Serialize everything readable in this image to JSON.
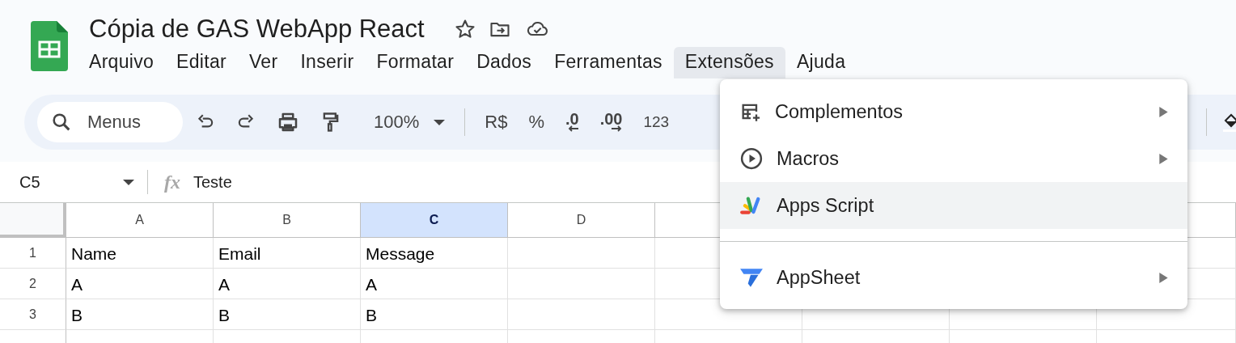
{
  "document": {
    "title": "Cópia de GAS WebApp React"
  },
  "menu_bar": [
    {
      "label": "Arquivo",
      "selected": false
    },
    {
      "label": "Editar",
      "selected": false
    },
    {
      "label": "Ver",
      "selected": false
    },
    {
      "label": "Inserir",
      "selected": false
    },
    {
      "label": "Formatar",
      "selected": false
    },
    {
      "label": "Dados",
      "selected": false
    },
    {
      "label": "Ferramentas",
      "selected": false
    },
    {
      "label": "Extensões",
      "selected": true
    },
    {
      "label": "Ajuda",
      "selected": false
    }
  ],
  "toolbar": {
    "search": {
      "placeholder": "Menus"
    },
    "zoom": "100%",
    "currency": "R$",
    "percent": "%",
    "decrease_decimals": ".0",
    "increase_decimals": ".00",
    "number_format": "123"
  },
  "formula_bar": {
    "cell_ref": "C5",
    "fx": "fx",
    "value": "Teste"
  },
  "sheet": {
    "columns": [
      {
        "label": "A",
        "selected": false
      },
      {
        "label": "B",
        "selected": false
      },
      {
        "label": "C",
        "selected": true
      },
      {
        "label": "D",
        "selected": false
      }
    ],
    "rows": [
      {
        "number": "1",
        "cells": [
          "Name",
          "Email",
          "Message"
        ]
      },
      {
        "number": "2",
        "cells": [
          "A",
          "A",
          "A"
        ]
      },
      {
        "number": "3",
        "cells": [
          "B",
          "B",
          "B"
        ]
      }
    ]
  },
  "dropdown_menu": [
    {
      "kind": "addons",
      "label": "Complementos",
      "submenu": true,
      "selected": false
    },
    {
      "kind": "macros",
      "label": "Macros",
      "submenu": true,
      "selected": false
    },
    {
      "kind": "script",
      "label": "Apps Script",
      "submenu": false,
      "selected": true
    },
    {
      "kind": "divider"
    },
    {
      "kind": "appsheet",
      "label": "AppSheet",
      "submenu": true,
      "selected": false
    }
  ]
}
